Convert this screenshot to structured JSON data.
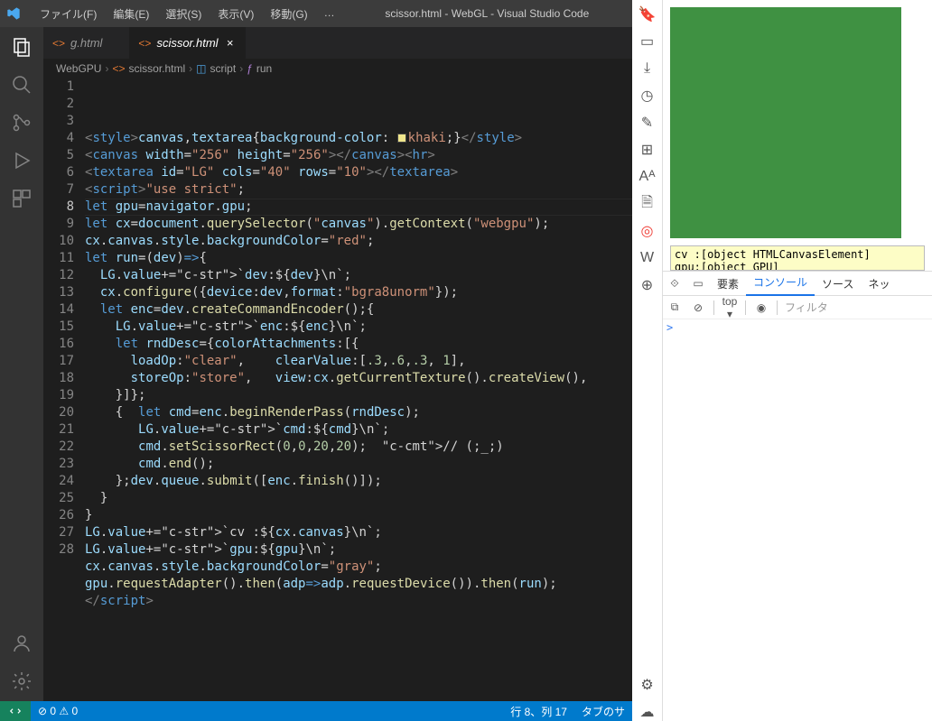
{
  "window": {
    "title": "scissor.html - WebGL - Visual Studio Code"
  },
  "menus": [
    "ファイル(F)",
    "編集(E)",
    "選択(S)",
    "表示(V)",
    "移動(G)",
    "…"
  ],
  "activitybar": [
    "explorer",
    "search",
    "scm",
    "debug",
    "extensions"
  ],
  "tabs": [
    {
      "icon": "<>",
      "label": "g.html",
      "active": false
    },
    {
      "icon": "<>",
      "label": "scissor.html",
      "active": true
    }
  ],
  "breadcrumbs": {
    "parts": [
      "WebGPU",
      "scissor.html",
      "script",
      "run"
    ]
  },
  "code": {
    "lines": [
      "<style>canvas,textarea{background-color: ▮khaki;}</style>",
      "<canvas width=\"256\" height=\"256\"></canvas><hr>",
      "<textarea id=\"LG\" cols=\"40\" rows=\"10\"></textarea>",
      "<script>\"use strict\";",
      "let gpu=navigator.gpu;",
      "let cx=document.querySelector(\"canvas\").getContext(\"webgpu\");",
      "cx.canvas.style.backgroundColor=\"red\";",
      "let run=(dev)=>{",
      "  LG.value+=`dev:${dev}\\n`;",
      "  cx.configure({device:dev,format:\"bgra8unorm\"});",
      "  let enc=dev.createCommandEncoder();{",
      "    LG.value+=`enc:${enc}\\n`;",
      "    let rndDesc={colorAttachments:[{",
      "      loadOp:\"clear\",    clearValue:[.3,.6,.3, 1],",
      "      storeOp:\"store\",   view:cx.getCurrentTexture().createView(),",
      "    }]};",
      "    {  let cmd=enc.beginRenderPass(rndDesc);",
      "       LG.value+=`cmd:${cmd}\\n`;",
      "       cmd.setScissorRect(0,0,20,20);  // (;_;)",
      "       cmd.end();",
      "    };dev.queue.submit([enc.finish()]);",
      "  }",
      "}",
      "LG.value+=`cv :${cx.canvas}\\n`;",
      "LG.value+=`gpu:${gpu}\\n`;",
      "cx.canvas.style.backgroundColor=\"gray\";",
      "gpu.requestAdapter().then(adp=>adp.requestDevice()).then(run);",
      "</ script>"
    ],
    "current_line": 8
  },
  "statusbar": {
    "errors": "⊘ 0 ⚠ 0",
    "pos": "行 8、列 17",
    "tabinfo": "タブのサ"
  },
  "browser": {
    "sidetabs": [
      "bookmark",
      "history",
      "download",
      "clock",
      "edit",
      "panel",
      "translate",
      "file",
      "vivaldi",
      "wiki",
      "plus"
    ],
    "log_lines": [
      "cv :[object HTMLCanvasElement]",
      "gpu:[object GPU]"
    ],
    "devtools": {
      "tabs": [
        "要素",
        "コンソール",
        "ソース",
        "ネッ"
      ],
      "active_tab": "コンソール",
      "context": "top ▾",
      "filter_placeholder": "フィルタ",
      "prompt": ">"
    }
  }
}
